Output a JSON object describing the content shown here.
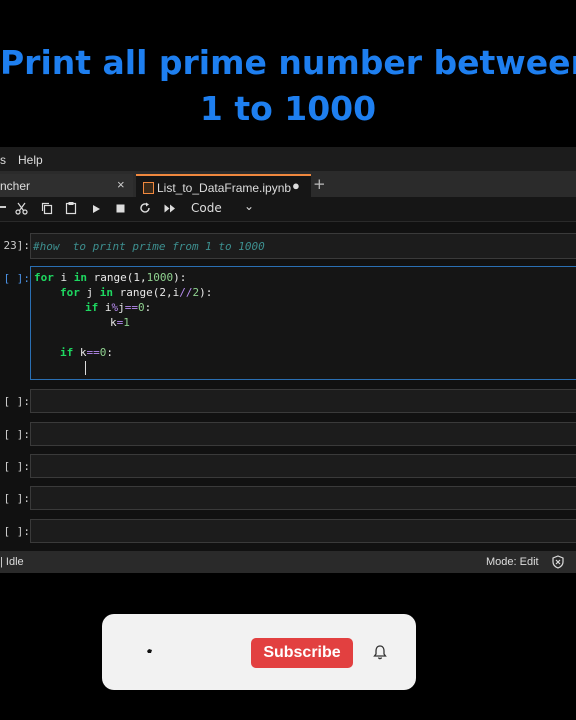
{
  "heading": {
    "line1": "Print all prime number between",
    "line2": "1 to 1000"
  },
  "menu": {
    "items": [
      "s",
      "Help"
    ]
  },
  "tabs": [
    {
      "label": "ncher",
      "close": "×"
    },
    {
      "label": "List_to_DataFrame.ipynb",
      "status": "●"
    }
  ],
  "tab_add": "+",
  "toolbar": {
    "cell_type": "Code",
    "dropdown": "⌄"
  },
  "cells": [
    {
      "prompt": "23]:",
      "comment": "#how  to print prime from 1 to 1000"
    },
    {
      "prompt": "[ ]:"
    },
    {
      "prompt": "[ ]:"
    },
    {
      "prompt": "[ ]:"
    },
    {
      "prompt": "[ ]:"
    },
    {
      "prompt": "[ ]:"
    },
    {
      "prompt": "[ ]:"
    }
  ],
  "code_tokens": {
    "l1": [
      "for",
      "i",
      "in",
      "range",
      "(1,",
      "1000",
      "):"
    ],
    "l2": [
      "for",
      "j",
      "in",
      "range",
      "(2,",
      "i",
      "//",
      "2",
      "):"
    ],
    "l3": [
      "if",
      "i",
      "%",
      "j",
      "==",
      "0",
      ":"
    ],
    "l4": [
      "k",
      "=",
      "1"
    ],
    "l5": [
      "if",
      "k",
      "==",
      "0",
      ":"
    ]
  },
  "status": {
    "left": "| Idle",
    "mode": "Mode: Edit"
  },
  "subscribe": {
    "label": "Subscribe"
  },
  "colors": {
    "title": "#1e7ff0",
    "subscribe": "#e24040",
    "active_cell": "#2a6fb3",
    "tab_accent": "#f0883e"
  }
}
